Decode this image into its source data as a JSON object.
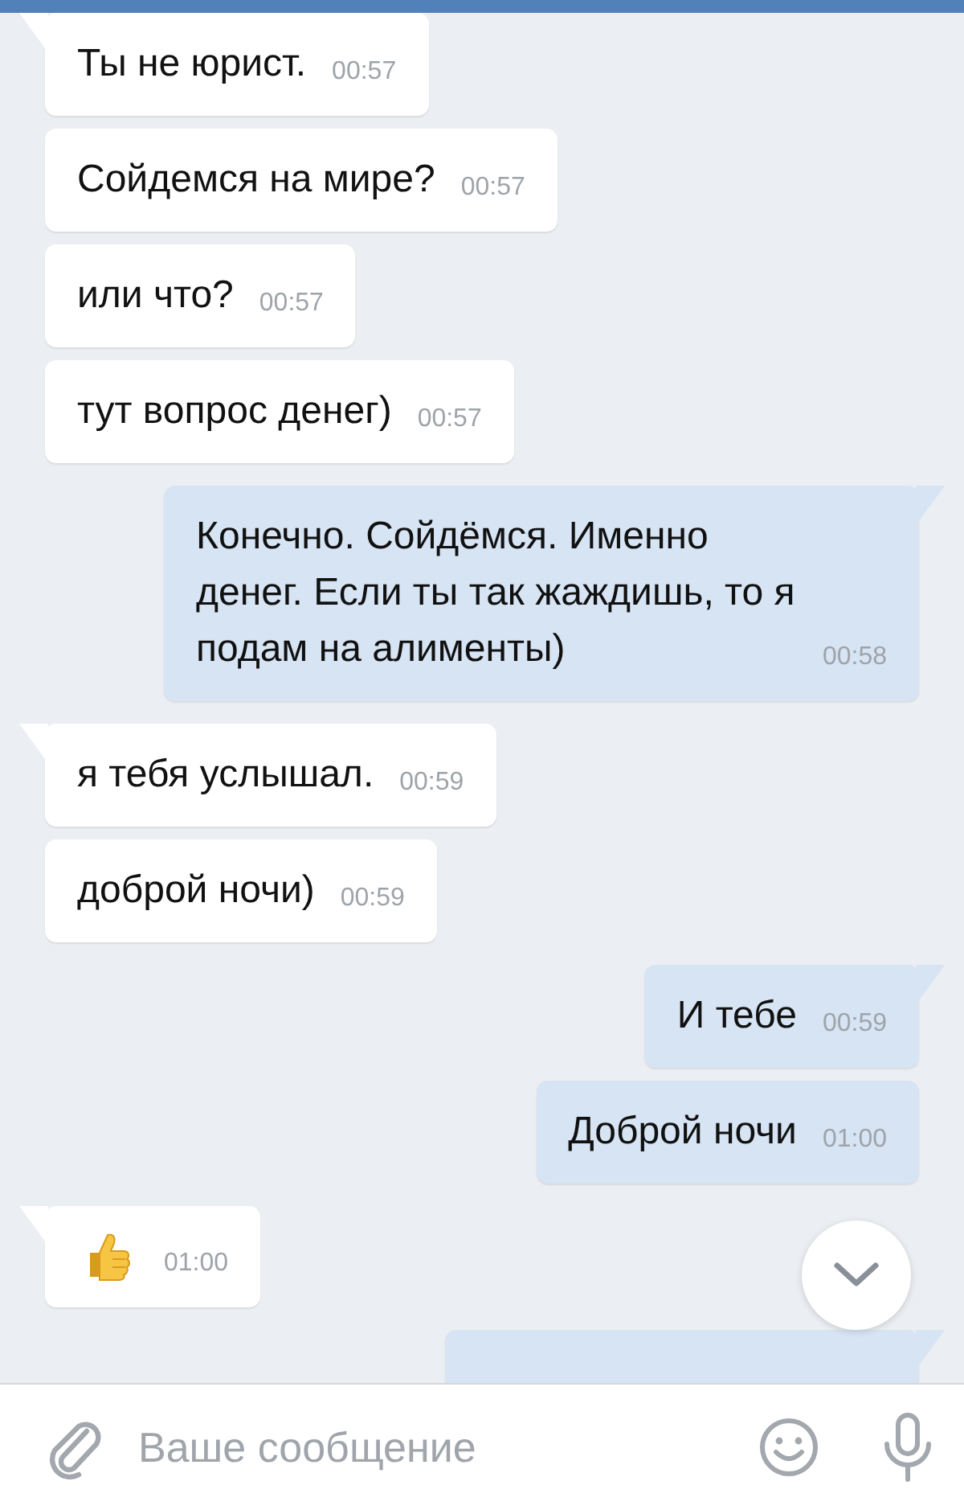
{
  "messages": [
    {
      "outgoing": false,
      "kind": "text",
      "text": "Ты не юрист.",
      "time": "00:57"
    },
    {
      "outgoing": false,
      "kind": "text",
      "text": "Сойдемся на мире?",
      "time": "00:57"
    },
    {
      "outgoing": false,
      "kind": "text",
      "text": "или что?",
      "time": "00:57"
    },
    {
      "outgoing": false,
      "kind": "text",
      "text": "тут вопрос денег)",
      "time": "00:57"
    },
    {
      "outgoing": true,
      "kind": "text",
      "text": "Конечно. Сойдёмся. Именно денег. Если ты так жаждишь, то я подам на алименты)",
      "time": "00:58"
    },
    {
      "outgoing": false,
      "kind": "text",
      "text": "я тебя услышал.",
      "time": "00:59"
    },
    {
      "outgoing": false,
      "kind": "text",
      "text": "доброй ночи)",
      "time": "00:59"
    },
    {
      "outgoing": true,
      "kind": "text",
      "text": "И тебе",
      "time": "00:59"
    },
    {
      "outgoing": true,
      "kind": "text",
      "text": "Доброй ночи",
      "time": "01:00"
    },
    {
      "outgoing": false,
      "kind": "like",
      "time": "01:00"
    },
    {
      "outgoing": true,
      "kind": "cut"
    }
  ],
  "composer": {
    "placeholder": "Ваше сообщение"
  }
}
